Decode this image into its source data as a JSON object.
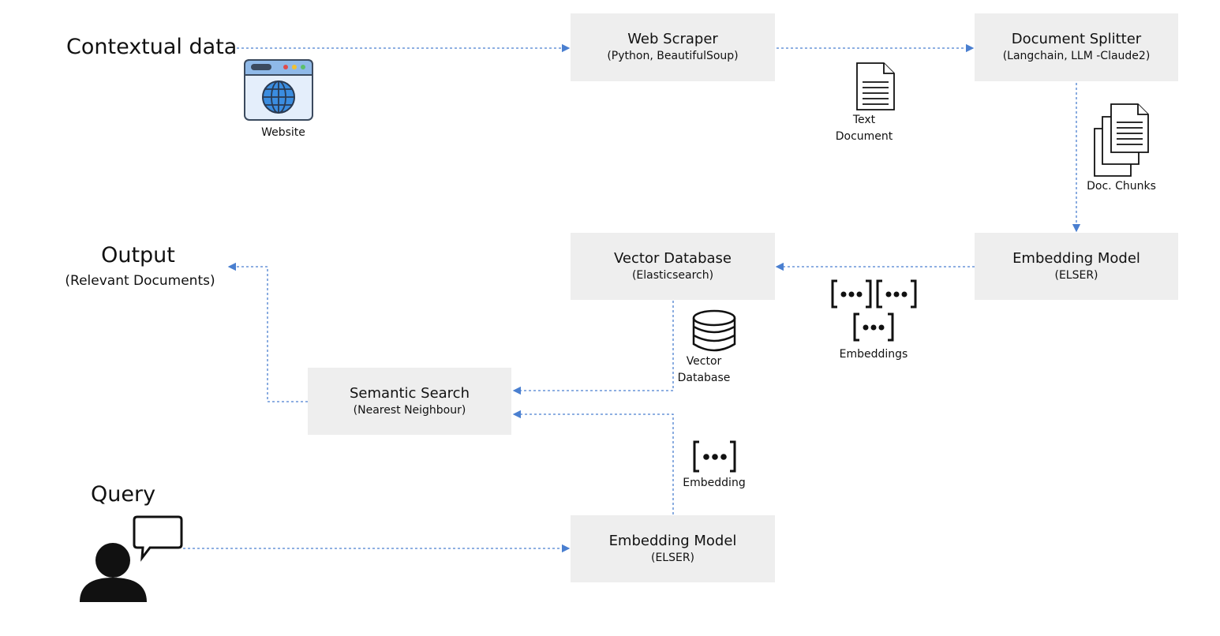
{
  "labels": {
    "contextual_data": "Contextual data",
    "output_title": "Output",
    "output_subtitle": "(Relevant Documents)",
    "query": "Query"
  },
  "boxes": {
    "web_scraper": {
      "title": "Web Scraper",
      "subtitle": "(Python, BeautifulSoup)"
    },
    "document_splitter": {
      "title": "Document Splitter",
      "subtitle": "(Langchain, LLM -Claude2)"
    },
    "vector_database": {
      "title": "Vector Database",
      "subtitle": "(Elasticsearch)"
    },
    "embedding_model_top": {
      "title": "Embedding Model",
      "subtitle": "(ELSER)"
    },
    "semantic_search": {
      "title": "Semantic Search",
      "subtitle": "(Nearest Neighbour)"
    },
    "embedding_model_bottom": {
      "title": "Embedding Model",
      "subtitle": "(ELSER)"
    }
  },
  "icons": {
    "website": {
      "icon": "website-globe-icon",
      "label": "Website"
    },
    "text_document": {
      "icon": "document-icon",
      "label_line1": "Text",
      "label_line2": "Document"
    },
    "doc_chunks": {
      "icon": "stacked-documents-icon",
      "label": "Doc. Chunks"
    },
    "embeddings": {
      "icon": "embedding-vectors-icon",
      "label": "Embeddings"
    },
    "vector_db": {
      "icon": "database-icon",
      "label_line1": "Vector",
      "label_line2": "Database"
    },
    "embedding": {
      "icon": "embedding-vector-icon",
      "label": "Embedding"
    },
    "user": {
      "icon": "user-speech-icon"
    }
  },
  "colors": {
    "arrow": "#4a7fd0",
    "box_fill": "#eeeeee"
  }
}
